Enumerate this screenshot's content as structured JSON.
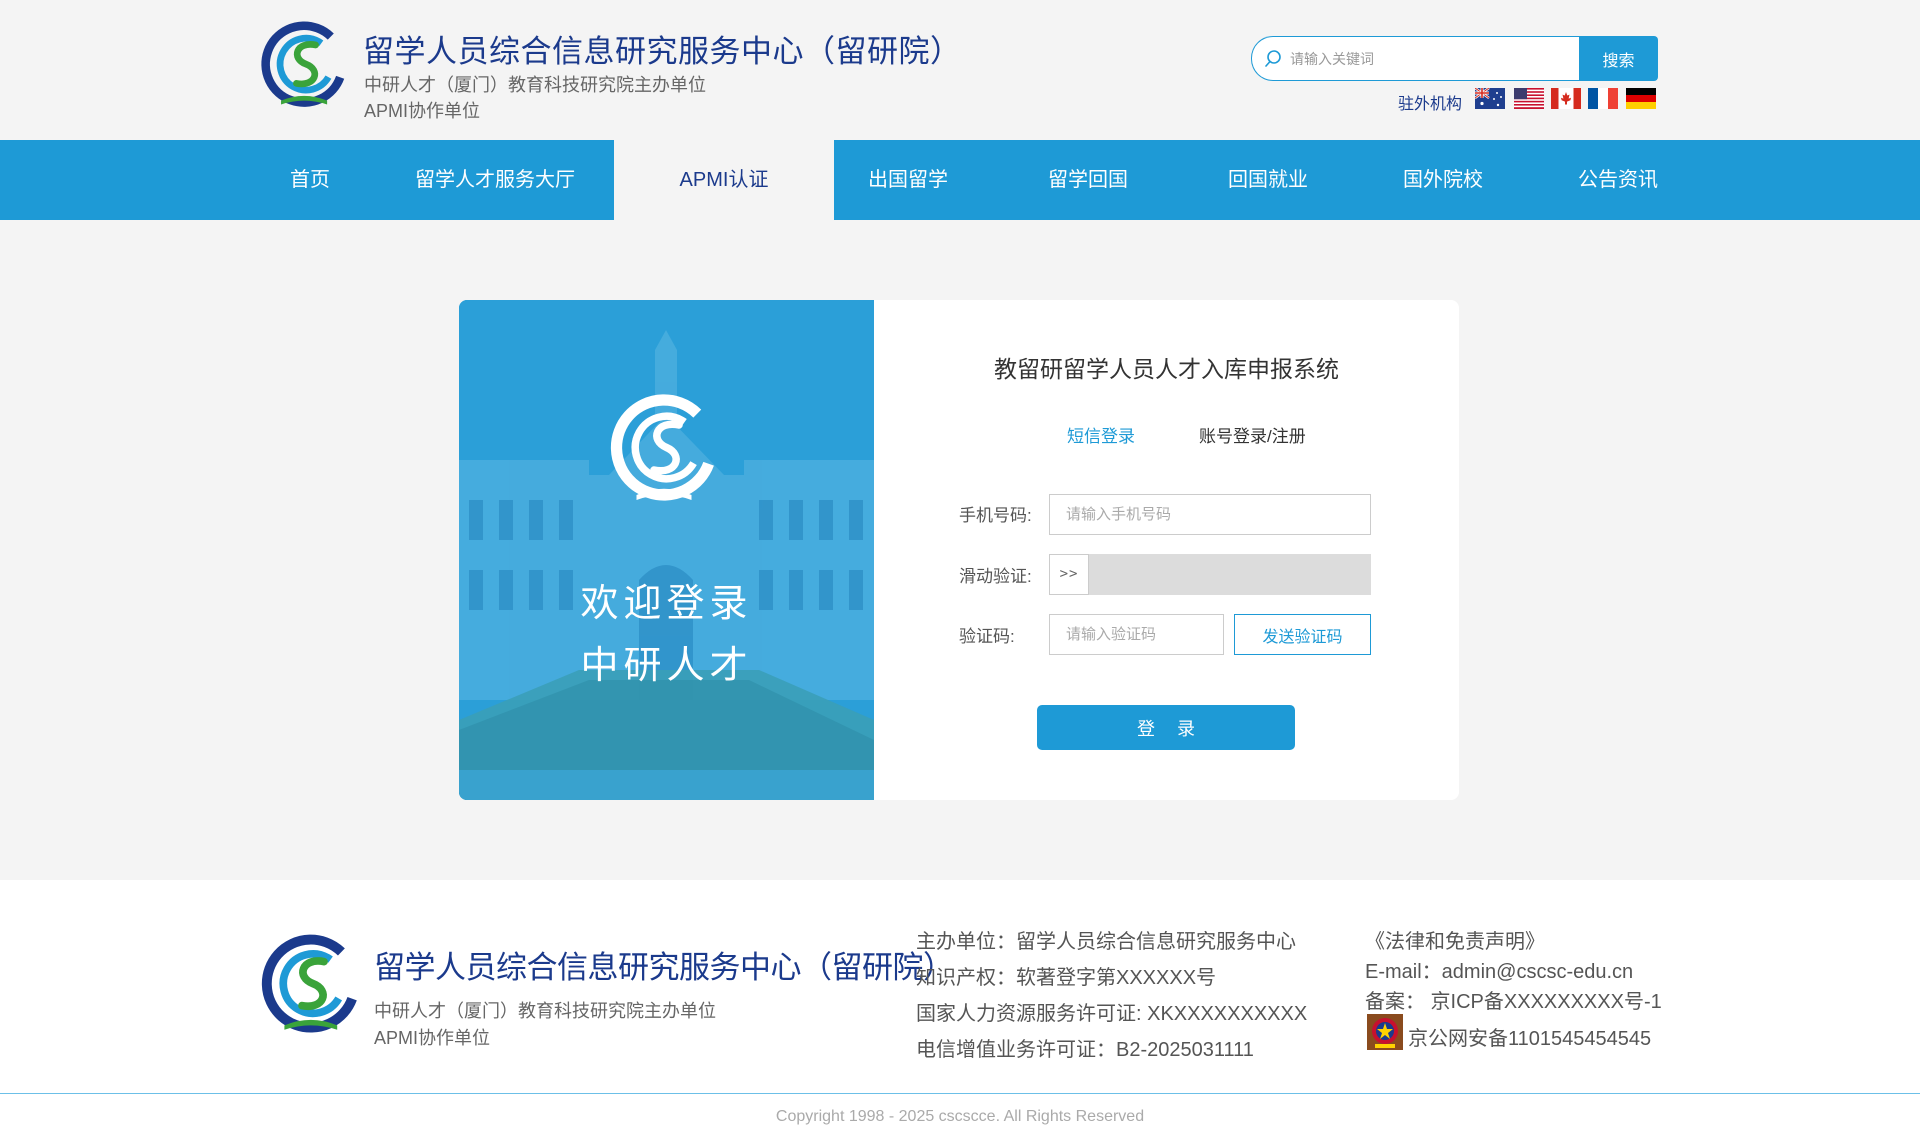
{
  "header": {
    "title": "留学人员综合信息研究服务中心（留研院）",
    "subtitle1": "中研人才（厦门）教育科技研究院主办单位",
    "subtitle2": "APMI协作单位",
    "search_placeholder": "请输入关键词",
    "search_button": "搜索",
    "abroad_label": "驻外机构",
    "flags": [
      "australia-flag",
      "usa-flag",
      "canada-flag",
      "france-flag",
      "germany-flag"
    ]
  },
  "nav": {
    "items": [
      {
        "label": "首页"
      },
      {
        "label": "留学人才服务大厅"
      },
      {
        "label": "APMI认证"
      },
      {
        "label": "出国留学"
      },
      {
        "label": "留学回国"
      },
      {
        "label": "回国就业"
      },
      {
        "label": "国外院校"
      },
      {
        "label": "公告资讯"
      }
    ],
    "active_index": 2
  },
  "login": {
    "welcome_line1": "欢迎登录",
    "welcome_line2": "中研人才",
    "title": "教留研留学人员人才入库申报系统",
    "tab_sms": "短信登录",
    "tab_account": "账号登录/注册",
    "phone_label": "手机号码:",
    "phone_placeholder": "请输入手机号码",
    "slider_label": "滑动验证:",
    "slider_handle": ">>",
    "code_label": "验证码:",
    "code_placeholder": "请输入验证码",
    "send_code_button": "发送验证码",
    "login_button": "登录"
  },
  "footer": {
    "title": "留学人员综合信息研究服务中心（留研院）",
    "subtitle1": "中研人才（厦门）教育科技研究院主办单位",
    "subtitle2": "APMI协作单位",
    "info": [
      "主办单位：留学人员综合信息研究服务中心",
      "知识产权：软著登字第XXXXXX号",
      "国家人力资源服务许可证: XKXXXXXXXXXX",
      "电信增值业务许可证：B2-2025031111"
    ],
    "legal_link": "《法律和免责声明》",
    "email": "E-mail：admin@cscsc-edu.cn",
    "icp": "备案： 京ICP备XXXXXXXXX号-1",
    "police": "京公网安备1101545454545",
    "copyright": "Copyright 1998 - 2025 cscscce. All Rights Reserved"
  },
  "colors": {
    "primary": "#1e9ad6",
    "title_blue": "#1b3a8c",
    "background": "#f4f4f4",
    "logo_green": "#3aa33a"
  }
}
